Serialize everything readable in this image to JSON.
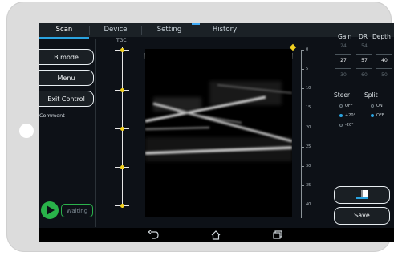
{
  "tabs": [
    {
      "label": "Scan"
    },
    {
      "label": "Device"
    },
    {
      "label": "Setting"
    },
    {
      "label": "History"
    }
  ],
  "left": {
    "b_mode": "B mode",
    "menu": "Menu",
    "exit_control": "Exit Control",
    "comment": "Comment",
    "waiting": "Waiting"
  },
  "tgc": {
    "label": "TGC"
  },
  "depth_scale": [
    "0",
    "5",
    "10",
    "15",
    "20",
    "25",
    "30",
    "35",
    "40"
  ],
  "params": {
    "headers": [
      "Gain",
      "DR",
      "Depth"
    ],
    "prev": [
      "24",
      "54",
      ""
    ],
    "current": [
      "27",
      "57",
      "40"
    ],
    "next": [
      "30",
      "60",
      "50"
    ]
  },
  "steer": {
    "label": "Steer",
    "options": [
      "OFF",
      "+20°",
      "-20°"
    ],
    "selected": "+20°"
  },
  "split": {
    "label": "Split",
    "options": [
      "ON",
      "OFF"
    ],
    "selected": "OFF"
  },
  "buttons": {
    "save": "Save"
  },
  "colors": {
    "accent": "#2aa3e0",
    "play": "#29b34a",
    "marker": "#f0d020"
  },
  "icons": [
    "play-icon",
    "split-view-icon",
    "back-icon",
    "home-icon",
    "recent-apps-icon"
  ]
}
